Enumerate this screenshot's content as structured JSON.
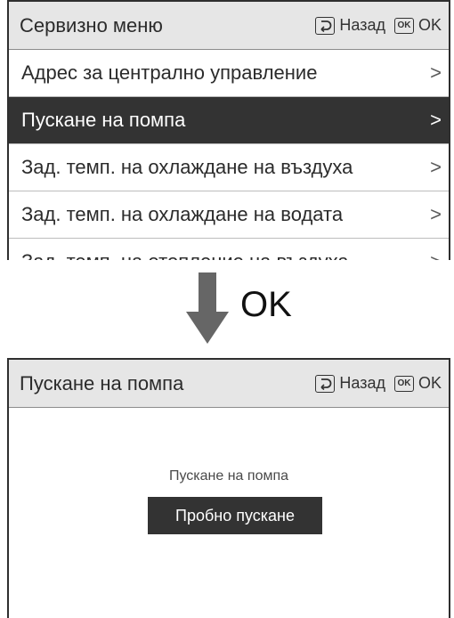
{
  "menu_screen": {
    "title": "Сервизно меню",
    "back_label": "Назад",
    "ok_label": "OK",
    "ok_icon_text": "OK",
    "items": [
      {
        "label": "Адрес за централно управление",
        "chevron": ">",
        "selected": false
      },
      {
        "label": "Пускане на помпа",
        "chevron": ">",
        "selected": true
      },
      {
        "label": "Зад. темп. на охлаждане на въздуха",
        "chevron": ">",
        "selected": false
      },
      {
        "label": "Зад. темп. на охлаждане на водата",
        "chevron": ">",
        "selected": false
      },
      {
        "label": "Зад. темп. на отопление на въздуха",
        "chevron": ">",
        "selected": false
      }
    ]
  },
  "transition": {
    "label": "OK"
  },
  "detail_screen": {
    "title": "Пускане на помпа",
    "back_label": "Назад",
    "ok_label": "OK",
    "ok_icon_text": "OK",
    "subtitle": "Пускане на помпа",
    "action_button": "Пробно пускане"
  },
  "colors": {
    "header_bg": "#e6e6e6",
    "selected_bg": "#333333",
    "arrow": "#666666"
  }
}
